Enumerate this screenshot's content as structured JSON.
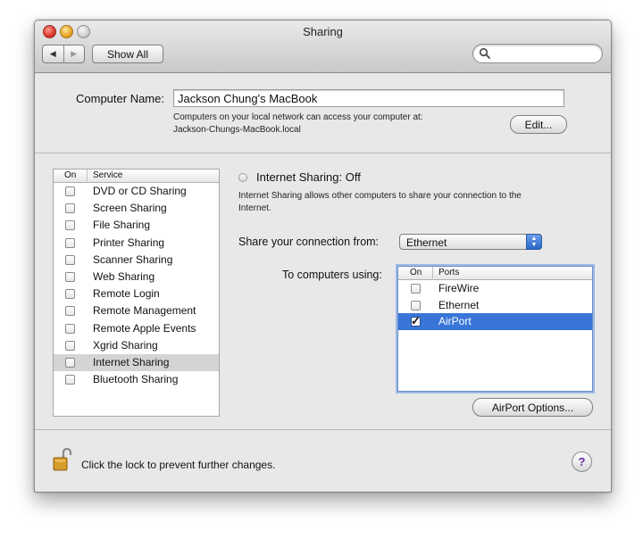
{
  "window": {
    "title": "Sharing"
  },
  "toolbar": {
    "back_icon": "◀",
    "forward_icon": "▶",
    "show_all_label": "Show All",
    "search_value": ""
  },
  "computer_name": {
    "label": "Computer Name:",
    "value": "Jackson Chung's MacBook",
    "info_line1": "Computers on your local network can access your computer at:",
    "info_line2": "Jackson-Chungs-MacBook.local",
    "edit_label": "Edit..."
  },
  "services": {
    "header_on": "On",
    "header_service": "Service",
    "items": [
      {
        "label": "DVD or CD Sharing",
        "checked": false
      },
      {
        "label": "Screen Sharing",
        "checked": false
      },
      {
        "label": "File Sharing",
        "checked": false
      },
      {
        "label": "Printer Sharing",
        "checked": false
      },
      {
        "label": "Scanner Sharing",
        "checked": false
      },
      {
        "label": "Web Sharing",
        "checked": false
      },
      {
        "label": "Remote Login",
        "checked": false
      },
      {
        "label": "Remote Management",
        "checked": false
      },
      {
        "label": "Remote Apple Events",
        "checked": false
      },
      {
        "label": "Xgrid Sharing",
        "checked": false
      },
      {
        "label": "Internet Sharing",
        "checked": false,
        "selected": true
      },
      {
        "label": "Bluetooth Sharing",
        "checked": false
      }
    ]
  },
  "internet_sharing": {
    "status_title": "Internet Sharing: Off",
    "description_line1": "Internet Sharing allows other computers to share your connection to the",
    "description_line2": "Internet.",
    "share_from_label": "Share your connection from:",
    "share_from_value": "Ethernet",
    "to_computers_label": "To computers using:",
    "ports_header_on": "On",
    "ports_header_ports": "Ports",
    "ports": [
      {
        "label": "FireWire",
        "checked": false
      },
      {
        "label": "Ethernet",
        "checked": false
      },
      {
        "label": "AirPort",
        "checked": true,
        "selected": true
      }
    ],
    "airport_options_label": "AirPort Options..."
  },
  "footer": {
    "lock_text": "Click the lock to prevent further changes.",
    "help_label": "?"
  },
  "colors": {
    "selection_blue": "#3875d7",
    "window_bg": "#e8e8e8"
  }
}
